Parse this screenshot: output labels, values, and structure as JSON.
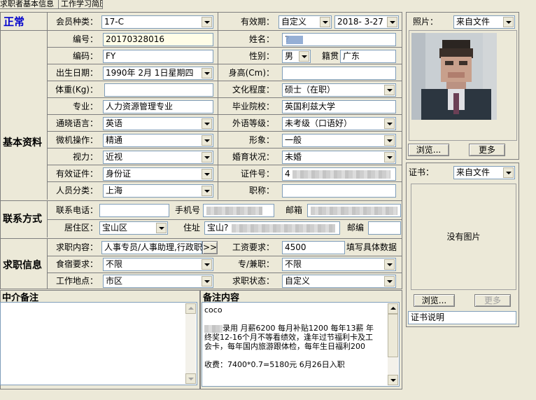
{
  "tabs": [
    "求职者基本信息",
    "工作学习简历"
  ],
  "status": "正常",
  "sections": {
    "basic": "基本资料",
    "contact": "联系方式",
    "job": "求职信息"
  },
  "member_type": {
    "label": "会员种类：",
    "value": "17-C"
  },
  "validity": {
    "label": "有效期：",
    "mode": "自定义",
    "date": "2018- 3-27"
  },
  "number": {
    "label": "编号：",
    "value": "20170328016"
  },
  "name": {
    "label": "姓名：",
    "value": "?"
  },
  "code": {
    "label": "编码：",
    "value": "FY"
  },
  "gender": {
    "label": "性别：",
    "value": "男"
  },
  "hometown": {
    "label": "籍贯",
    "value": "广东"
  },
  "birthday": {
    "label": "出生日期：",
    "value": "1990年 2月 1日星期四"
  },
  "height": {
    "label": "身高(Cm)：",
    "value": ""
  },
  "weight": {
    "label": "体重(Kg)：",
    "value": ""
  },
  "education": {
    "label": "文化程度：",
    "value": "硕士（在职）"
  },
  "major": {
    "label": "专业：",
    "value": "人力资源管理专业"
  },
  "school": {
    "label": "毕业院校：",
    "value": "英国利兹大学"
  },
  "language": {
    "label": "通晓语言：",
    "value": "英语"
  },
  "foreign_level": {
    "label": "外语等级：",
    "value": "未考级（口语好）"
  },
  "computer": {
    "label": "微机操作：",
    "value": "精通"
  },
  "appearance": {
    "label": "形象：",
    "value": "一般"
  },
  "vision": {
    "label": "视力：",
    "value": "近视"
  },
  "marriage": {
    "label": "婚育状况：",
    "value": "未婚"
  },
  "id_type": {
    "label": "有效证件：",
    "value": "身份证"
  },
  "id_number": {
    "label": "证件号：",
    "value": "4"
  },
  "category": {
    "label": "人员分类：",
    "value": "上海"
  },
  "title": {
    "label": "职称：",
    "value": ""
  },
  "phone": {
    "label": "联系电话：",
    "value": ""
  },
  "mobile": {
    "label": "手机号",
    "value": ""
  },
  "email": {
    "label": "邮箱",
    "value": ""
  },
  "district": {
    "label": "居住区：",
    "value": "宝山区"
  },
  "address": {
    "label": "住址",
    "value": "宝山?"
  },
  "postcode": {
    "label": "邮编",
    "value": ""
  },
  "job_content": {
    "label": "求职内容：",
    "value": "人事专员/人事助理,行政职",
    "more": ">>"
  },
  "salary": {
    "label": "工资要求：",
    "value": "4500",
    "hint": "填写具体数据"
  },
  "lodging": {
    "label": "食宿要求：",
    "value": "不限"
  },
  "fulltime": {
    "label": "专/兼职：",
    "value": "不限"
  },
  "location": {
    "label": "工作地点：",
    "value": "市区"
  },
  "job_status": {
    "label": "求职状态：",
    "value": "自定义"
  },
  "agent_note": {
    "label": "中介备注",
    "value": ""
  },
  "remark": {
    "label": "备注内容",
    "lines": [
      "coco",
      "",
      "录用 月薪6200 每月补贴1200 每年13薪 年",
      "终奖12-16个月不等看绩效，逢年过节福利卡及工",
      "会卡，每年国内旅游跟体检，每年生日福利200",
      "",
      "收费：7400*0.7=5180元 6月26日入职"
    ]
  },
  "photo": {
    "label": "照片：",
    "source": "来自文件",
    "browse": "浏览...",
    "more": "更多"
  },
  "cert": {
    "label": "证书：",
    "source": "来自文件",
    "empty": "没有图片",
    "browse": "浏览...",
    "more": "更多",
    "desc": "证书说明"
  },
  "colors": {
    "status": "#0000cc",
    "bg": "#ece9d8",
    "field_border": "#7f9db9"
  }
}
